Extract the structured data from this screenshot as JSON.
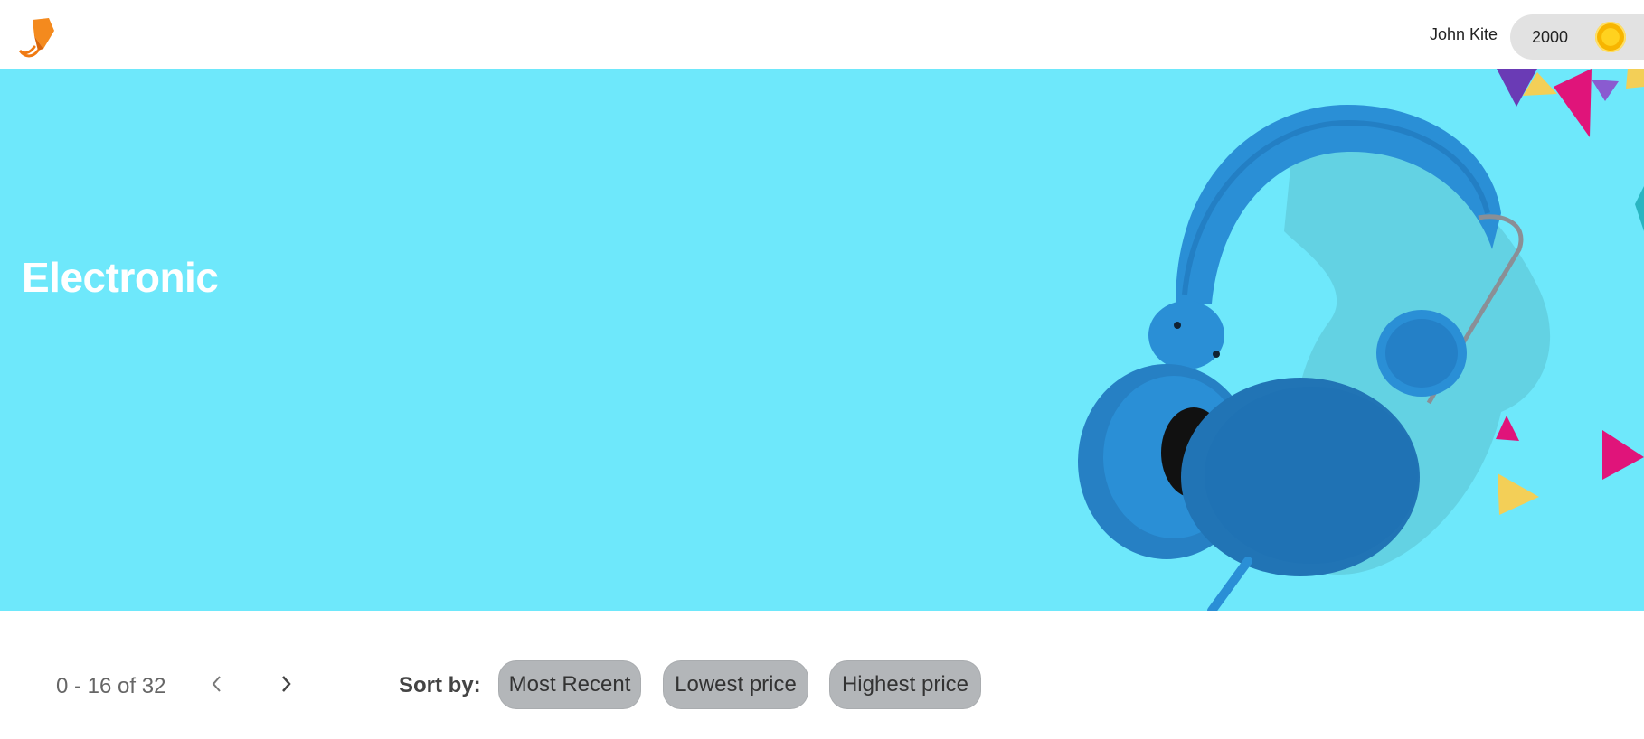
{
  "header": {
    "logo_icon": "kite-logo-icon",
    "user_name": "John Kite",
    "coins": "2000",
    "coin_icon": "coin-icon"
  },
  "hero": {
    "title": "Electronic",
    "background_color": "#6ee8fb",
    "image": "headphones-illustration"
  },
  "pagination": {
    "range_text": "0 - 16 of 32",
    "prev_icon": "chevron-left-icon",
    "next_icon": "chevron-right-icon"
  },
  "sort": {
    "label": "Sort by:",
    "options": [
      "Most Recent",
      "Lowest price",
      "Highest price"
    ]
  },
  "colors": {
    "accent_orange": "#f07a12",
    "coin_gold": "#f7b500",
    "sort_button_bg": "#b3b6b9",
    "headphone_blue": "#2a8fd6"
  }
}
